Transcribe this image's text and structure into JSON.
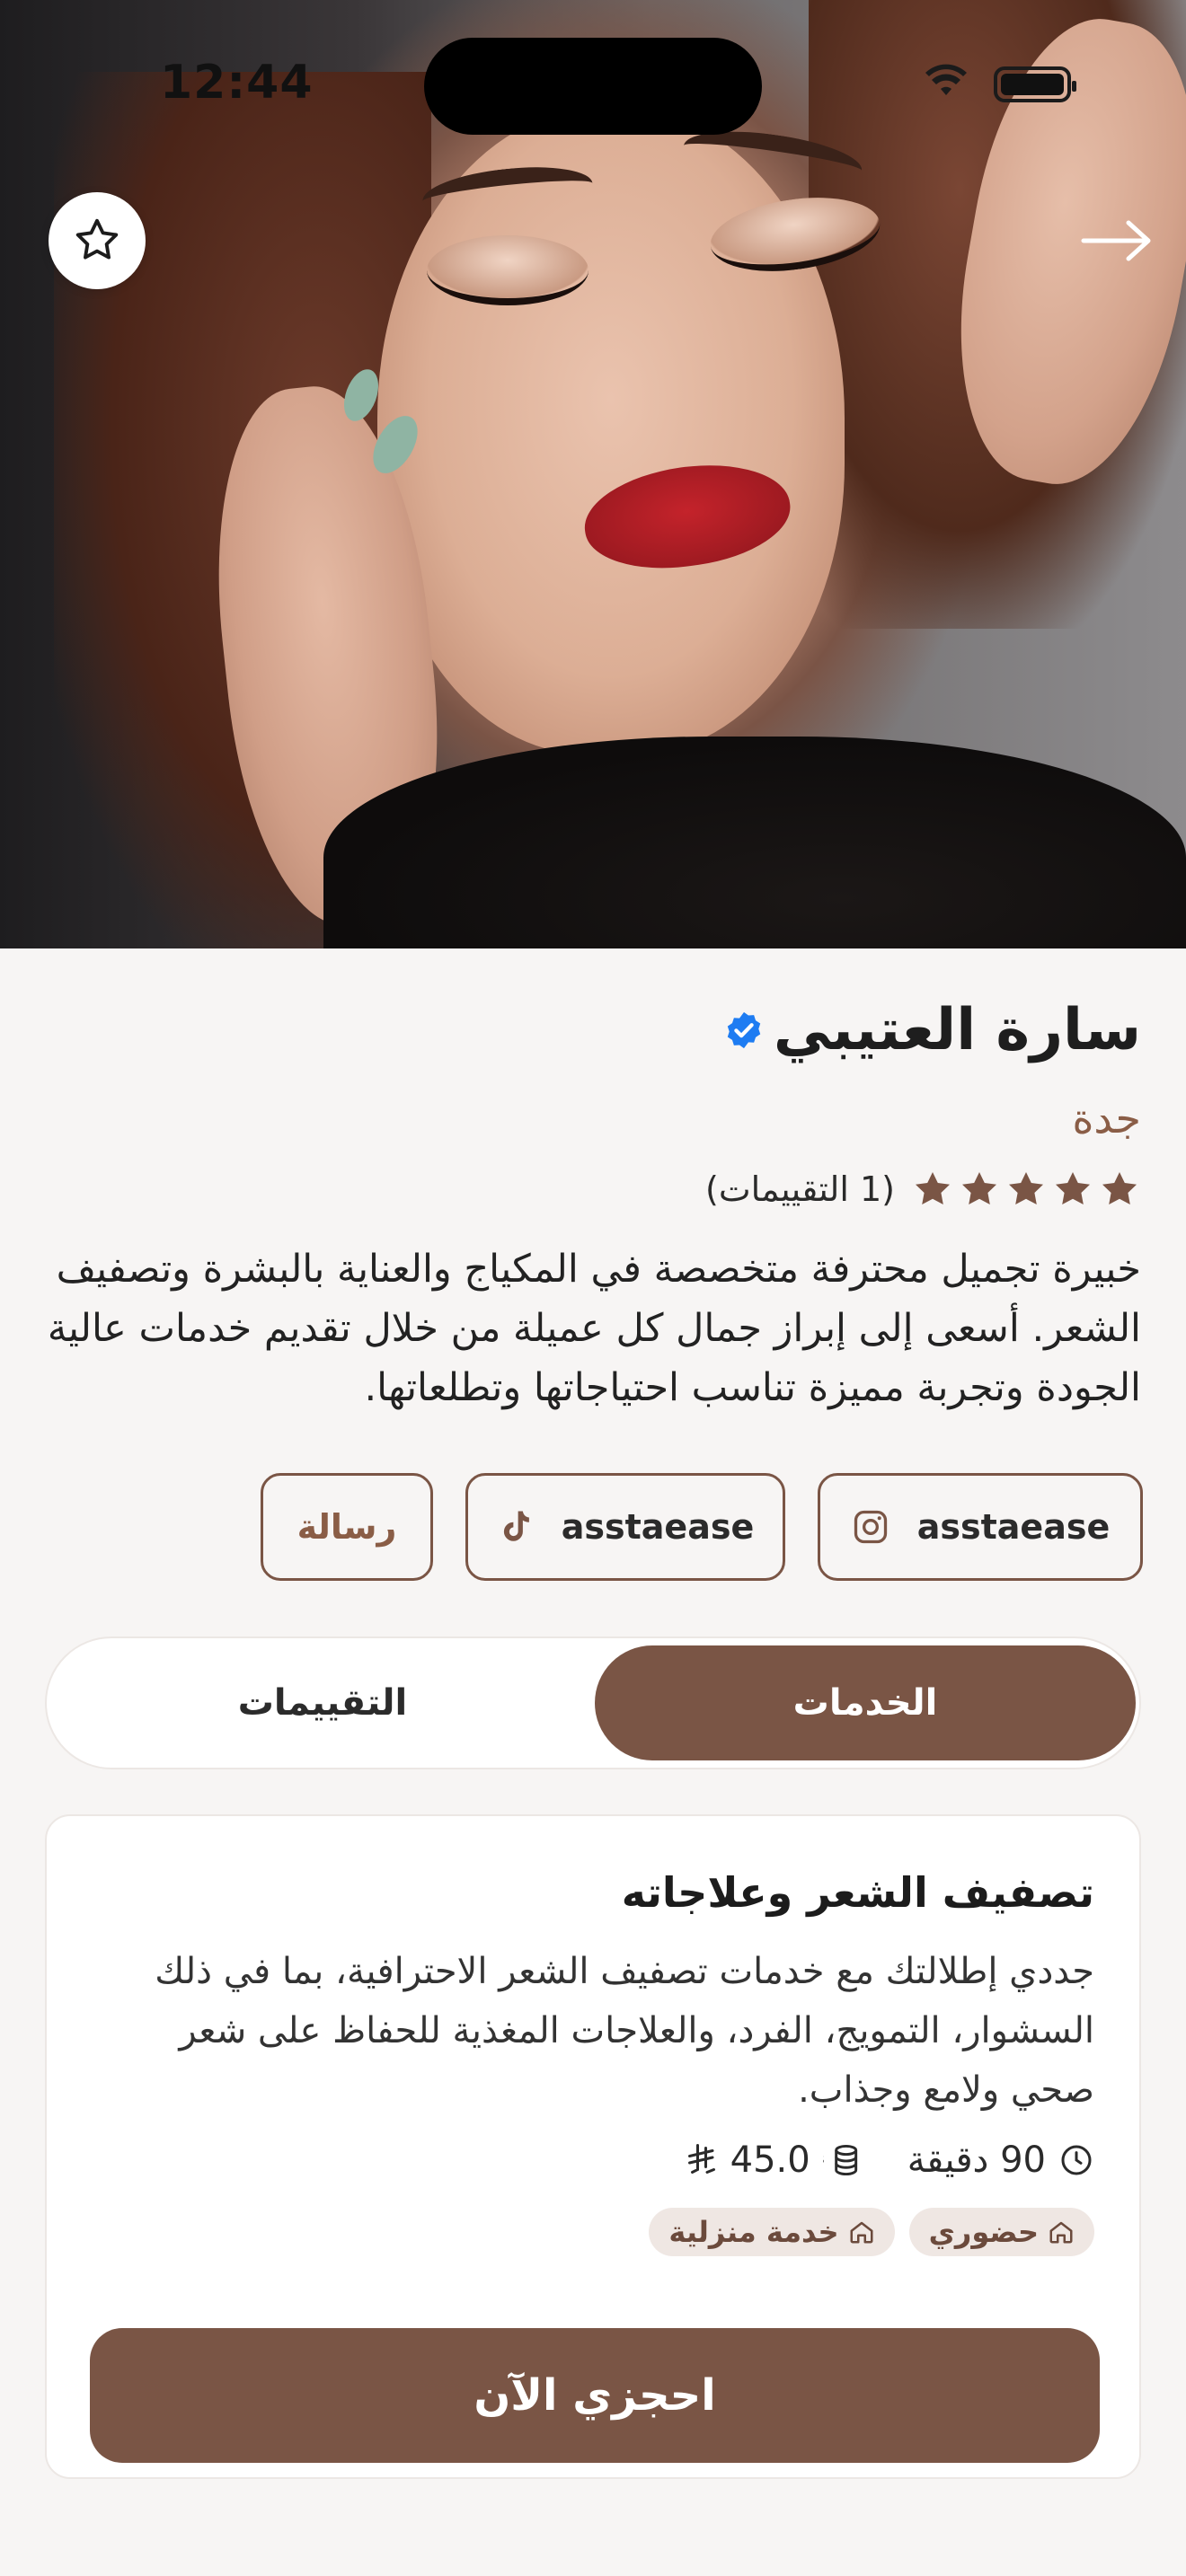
{
  "status_bar": {
    "time": "12:44"
  },
  "provider": {
    "name": "سارة العتيبي",
    "city": "جدة",
    "rating_stars": 5,
    "rating_count_text": "(1 التقييمات)",
    "bio": "خبيرة تجميل محترفة متخصصة في المكياج والعناية بالبشرة وتصفيف الشعر. أسعى إلى إبراز جمال كل عميلة من خلال تقديم خدمات عالية الجودة وتجربة مميزة تناسب احتياجاتها وتطلعاتها."
  },
  "social": {
    "instagram": "asstaease",
    "tiktok": "asstaease",
    "message": "رسالة"
  },
  "tabs": {
    "services": "الخدمات",
    "reviews": "التقييمات"
  },
  "service": {
    "title": "تصفيف الشعر وعلاجاته",
    "description": "جددي إطلالتك مع خدمات تصفيف الشعر الاحترافية، بما في ذلك السشوار، التمويج، الفرد، والعلاجات المغذية للحفاظ على شعر صحي ولامع وجذاب.",
    "duration": "90 دقيقة",
    "price": "45.0",
    "currency_symbol": "⃁",
    "chips": [
      "حضوري",
      "خدمة منزلية"
    ],
    "book_label": "احجزي الآن"
  },
  "colors": {
    "accent": "#7a5545",
    "verified": "#1e7cf2",
    "star": "#7a5545"
  },
  "icons": {
    "favorite": "star-outline-icon",
    "back": "arrow-right-icon",
    "instagram": "instagram-icon",
    "tiktok": "tiktok-icon",
    "clock": "clock-icon",
    "coins": "coins-icon",
    "home": "home-icon",
    "verified": "verified-badge-icon"
  }
}
